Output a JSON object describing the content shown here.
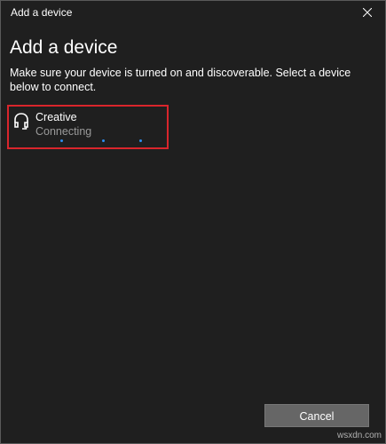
{
  "window": {
    "title": "Add a device"
  },
  "main": {
    "heading": "Add a device",
    "instructions": "Make sure your device is turned on and discoverable. Select a device below to connect."
  },
  "device": {
    "icon": "headphones-icon",
    "name": "Creative",
    "status": "Connecting"
  },
  "footer": {
    "cancel_label": "Cancel"
  },
  "watermark": "wsxdn.com",
  "colors": {
    "background": "#1f1f1f",
    "highlight_border": "#d9252c",
    "progress_dot": "#2b8ef0",
    "button": "#666666"
  }
}
